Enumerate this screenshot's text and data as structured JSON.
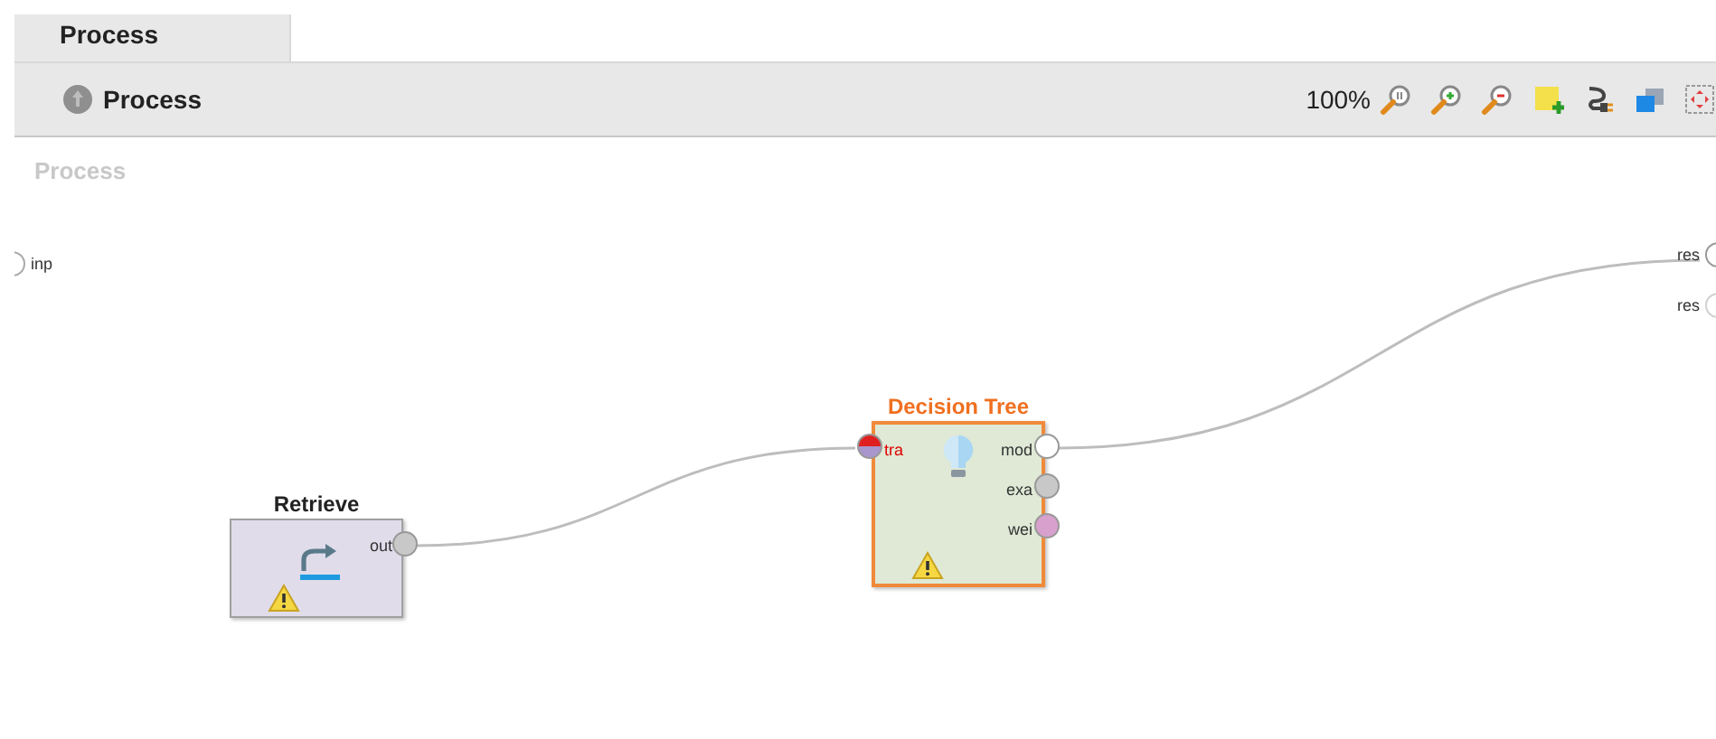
{
  "tabs": [
    {
      "label": "Process",
      "selected": true
    }
  ],
  "toolbar": {
    "title": "Process",
    "zoom": "100%"
  },
  "canvas": {
    "label": "Process",
    "input_ports": [
      {
        "label": "inp"
      }
    ],
    "output_ports": [
      {
        "label": "res",
        "connected": true
      },
      {
        "label": "res",
        "connected": false
      }
    ],
    "operators": [
      {
        "name": "Retrieve",
        "selected": false,
        "warning": true,
        "kind": "retrieve",
        "ports": [
          {
            "label": "out",
            "kind": "output",
            "color": "#c8c8c8",
            "error": false
          }
        ]
      },
      {
        "name": "Decision Tree",
        "selected": true,
        "warning": true,
        "kind": "learner",
        "ports": [
          {
            "label": "tra",
            "kind": "input",
            "color": "#a896cc",
            "error": true
          },
          {
            "label": "mod",
            "kind": "output",
            "color": "#ffffff",
            "error": false
          },
          {
            "label": "exa",
            "kind": "output",
            "color": "#c8c8c8",
            "error": false
          },
          {
            "label": "wei",
            "kind": "output",
            "color": "#d8a0cc",
            "error": false
          }
        ]
      }
    ]
  }
}
